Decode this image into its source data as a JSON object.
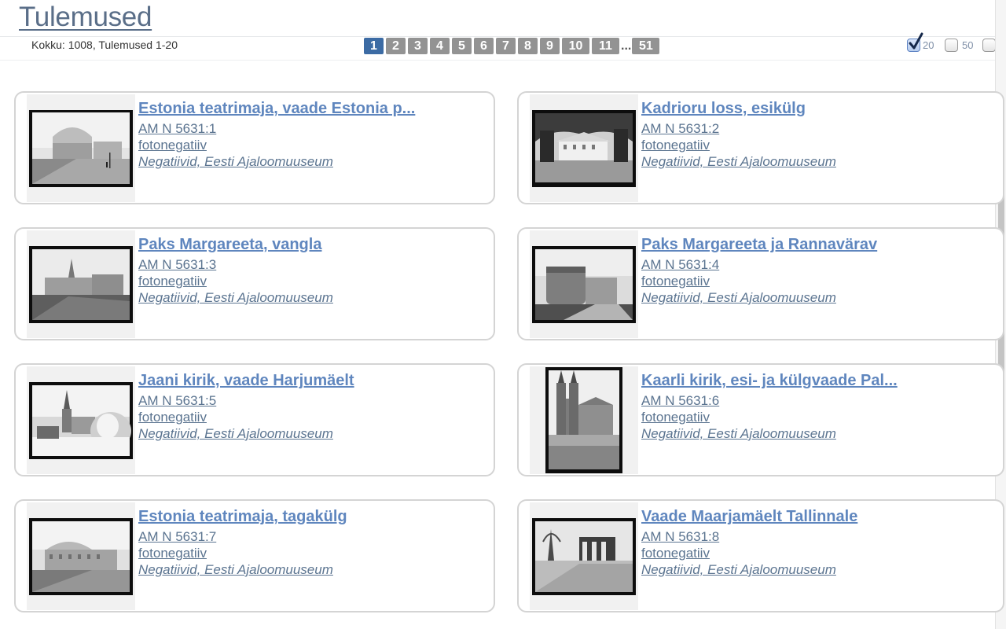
{
  "header": {
    "title": "Tulemused",
    "total": "Kokku: 1008, Tulemused 1-20"
  },
  "pagination": {
    "pages": [
      "1",
      "2",
      "3",
      "4",
      "5",
      "6",
      "7",
      "8",
      "9",
      "10",
      "11"
    ],
    "ellipsis": "...",
    "last": "51",
    "current": "1"
  },
  "per_page": {
    "options": [
      {
        "label": "20",
        "checked": true
      },
      {
        "label": "50",
        "checked": false
      },
      {
        "label": "",
        "checked": false
      }
    ]
  },
  "colors": {
    "link": "#5f86be",
    "active_page": "#3c6ba4",
    "inactive_page": "#939393"
  },
  "results": [
    {
      "title": "Estonia teatrimaja, vaade Estonia p...",
      "id": "AM N 5631:1",
      "type": "fotonegatiiv",
      "collection": "Negatiivid, Eesti Ajaloomuuseum",
      "thumbnail": "photo-thumbnail"
    },
    {
      "title": "Kadrioru loss, esikülg",
      "id": "AM N 5631:2",
      "type": "fotonegatiiv",
      "collection": "Negatiivid, Eesti Ajaloomuuseum",
      "thumbnail": "photo-thumbnail"
    },
    {
      "title": "Paks Margareeta, vangla",
      "id": "AM N 5631:3",
      "type": "fotonegatiiv",
      "collection": "Negatiivid, Eesti Ajaloomuuseum",
      "thumbnail": "photo-thumbnail"
    },
    {
      "title": "Paks Margareeta ja Rannavärav",
      "id": "AM N 5631:4",
      "type": "fotonegatiiv",
      "collection": "Negatiivid, Eesti Ajaloomuuseum",
      "thumbnail": "photo-thumbnail"
    },
    {
      "title": "Jaani kirik, vaade Harjumäelt",
      "id": "AM N 5631:5",
      "type": "fotonegatiiv",
      "collection": "Negatiivid, Eesti Ajaloomuuseum",
      "thumbnail": "photo-thumbnail"
    },
    {
      "title": "Kaarli kirik, esi- ja külgvaade Pal...",
      "id": "AM N 5631:6",
      "type": "fotonegatiiv",
      "collection": "Negatiivid, Eesti Ajaloomuuseum",
      "thumbnail": "photo-thumbnail"
    },
    {
      "title": "Estonia teatrimaja, tagakülg",
      "id": "AM N 5631:7",
      "type": "fotonegatiiv",
      "collection": "Negatiivid, Eesti Ajaloomuuseum",
      "thumbnail": "photo-thumbnail"
    },
    {
      "title": "Vaade Maarjamäelt Tallinnale",
      "id": "AM N 5631:8",
      "type": "fotonegatiiv",
      "collection": "Negatiivid, Eesti Ajaloomuuseum",
      "thumbnail": "photo-thumbnail"
    }
  ]
}
